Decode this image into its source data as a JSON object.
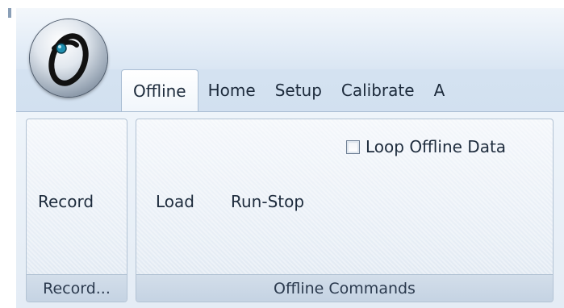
{
  "tabs": [
    {
      "label": "Offline",
      "active": true
    },
    {
      "label": "Home",
      "active": false
    },
    {
      "label": "Setup",
      "active": false
    },
    {
      "label": "Calibrate",
      "active": false
    },
    {
      "label": "A",
      "active": false
    }
  ],
  "groups": {
    "record": {
      "caption": "Record...",
      "buttons": {
        "record": "Record"
      }
    },
    "offline_commands": {
      "caption": "Offline Commands",
      "buttons": {
        "load": "Load",
        "run_stop": "Run-Stop"
      },
      "loop_checkbox": {
        "label": "Loop Offline Data",
        "checked": false
      }
    }
  },
  "icons": {
    "app_orb": "app-logo-icon"
  },
  "colors": {
    "ribbon_background": "#e4ecf5",
    "group_border": "#b3c3d4",
    "text": "#1d2b3c",
    "orb_accent": "#1f8fb0"
  }
}
